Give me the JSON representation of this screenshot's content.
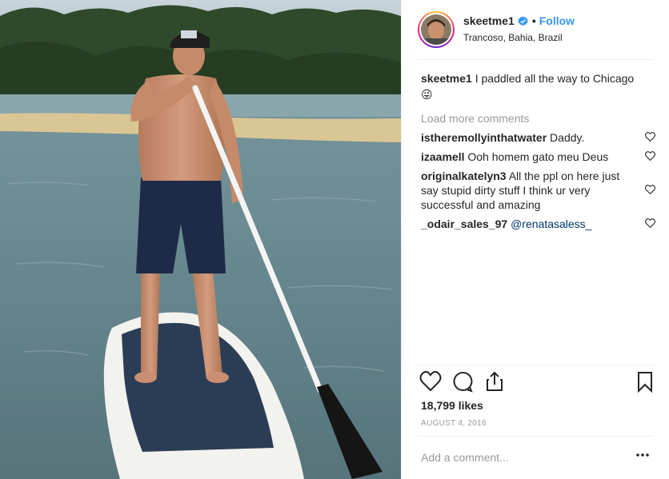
{
  "post": {
    "username": "skeetme1",
    "follow_label": "Follow",
    "separator": "•",
    "location": "Trancoso, Bahia, Brazil",
    "caption_username": "skeetme1",
    "caption_text": "I paddled all the way to Chicago",
    "caption_emoji": "😜",
    "load_more": "Load more comments",
    "comments": [
      {
        "user": "istheremollyinthatwater",
        "text": "Daddy."
      },
      {
        "user": "izaamell",
        "text": "Ooh homem gato meu Deus"
      },
      {
        "user": "originalkatelyn3",
        "text": "All the ppl on here just say stupid dirty stuff I think ur very successful and amazing"
      },
      {
        "user": "_odair_sales_97",
        "text": "@renatasaless_"
      }
    ],
    "likes": "18,799 likes",
    "date": "AUGUST 4, 2016",
    "add_comment_placeholder": "Add a comment...",
    "more_icon": "ellipsis-icon"
  },
  "colors": {
    "accent": "#3897f0",
    "muted": "#999999",
    "text": "#262626"
  }
}
